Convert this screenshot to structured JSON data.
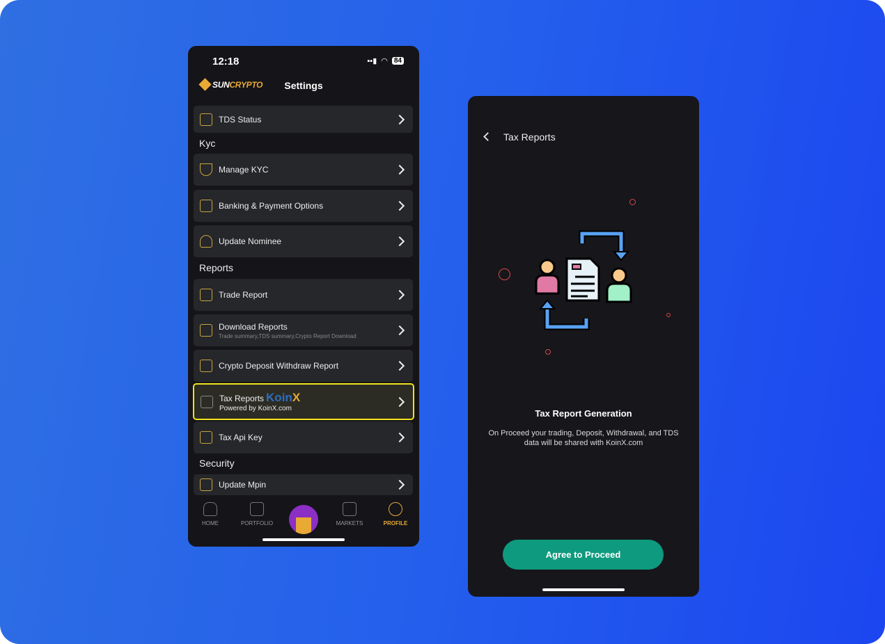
{
  "left_screen": {
    "status": {
      "time": "12:18",
      "battery": "84"
    },
    "brand": {
      "logo_a": "SUN",
      "logo_b": "CRYPTO"
    },
    "title": "Settings",
    "items": [
      {
        "label": "TDS Status"
      },
      {
        "section": "Kyc"
      },
      {
        "label": "Manage KYC"
      },
      {
        "label": "Banking & Payment Options"
      },
      {
        "label": "Update Nominee"
      },
      {
        "section": "Reports"
      },
      {
        "label": "Trade Report"
      },
      {
        "label": "Download Reports",
        "sub": "Trade summary,TDS summary,Crypto Report Download"
      },
      {
        "label": "Crypto Deposit Withdraw Report"
      },
      {
        "label": "Tax Reports",
        "badge_a": "Koin",
        "badge_b": "X",
        "sub": "Powered by KoinX.com",
        "highlighted": true
      },
      {
        "label": "Tax Api Key"
      },
      {
        "section": "Security"
      },
      {
        "label": "Update Mpin"
      }
    ],
    "nav": [
      {
        "label": "HOME"
      },
      {
        "label": "PORTFOLIO"
      },
      {
        "label": "MARKETS"
      },
      {
        "label": "PROFILE",
        "active": true
      }
    ],
    "colors": {
      "accent": "#e8a935",
      "highlight": "#f2e21e"
    }
  },
  "right_screen": {
    "title": "Tax Reports",
    "heading": "Tax Report Generation",
    "description": "On Proceed your trading, Deposit, Withdrawal, and TDS data will be shared with KoinX.com",
    "button": "Agree to Proceed",
    "colors": {
      "button": "#0e9a7e"
    }
  }
}
